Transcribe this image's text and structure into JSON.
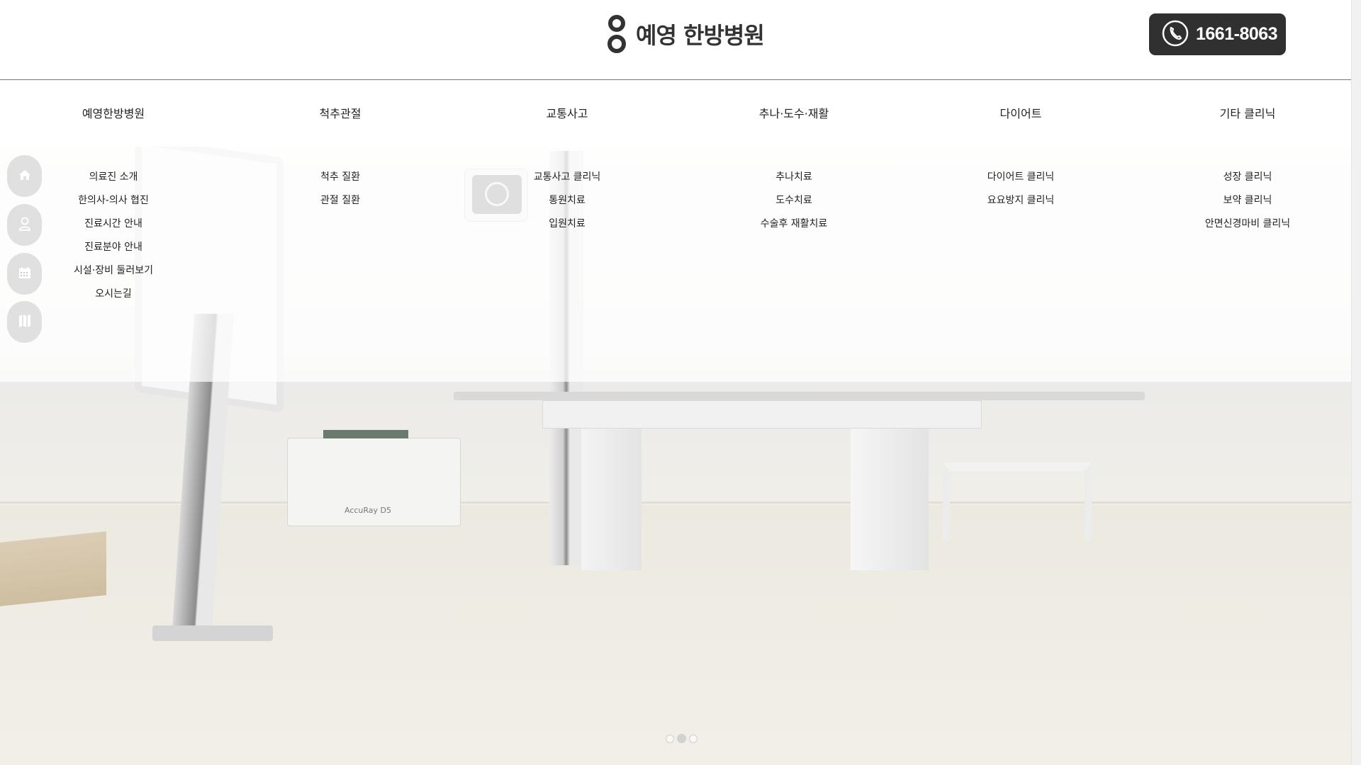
{
  "header": {
    "logo_text": "예영 한방병원",
    "phone": "1661-8063",
    "phone_icon": "phone-icon"
  },
  "menu": [
    {
      "label": "예영한방병원",
      "items": [
        "의료진 소개",
        "한의사-의사 협진",
        "진료시간 안내",
        "진료분야 안내",
        "시설·장비 둘러보기",
        "오시는길"
      ]
    },
    {
      "label": "척추관절",
      "items": [
        "척추 질환",
        "관절 질환"
      ]
    },
    {
      "label": "교통사고",
      "items": [
        "교통사고 클리닉",
        "통원치료",
        "입원치료"
      ]
    },
    {
      "label": "추나·도수·재활",
      "items": [
        "추나치료",
        "도수치료",
        "수술후 재활치료"
      ]
    },
    {
      "label": "다이어트",
      "items": [
        "다이어트 클리닉",
        "요요방지 클리닉"
      ]
    },
    {
      "label": "기타 클리닉",
      "items": [
        "성장 클리닉",
        "보약 클리닉",
        "안면신경마비 클리닉"
      ]
    }
  ],
  "quick_icons": [
    "home-icon",
    "user-icon",
    "calendar-icon",
    "map-icon"
  ],
  "slider": {
    "count": 3,
    "active": 2
  },
  "colors": {
    "accent": "#303030",
    "text": "#222222",
    "divider": "#7a7a7a"
  }
}
